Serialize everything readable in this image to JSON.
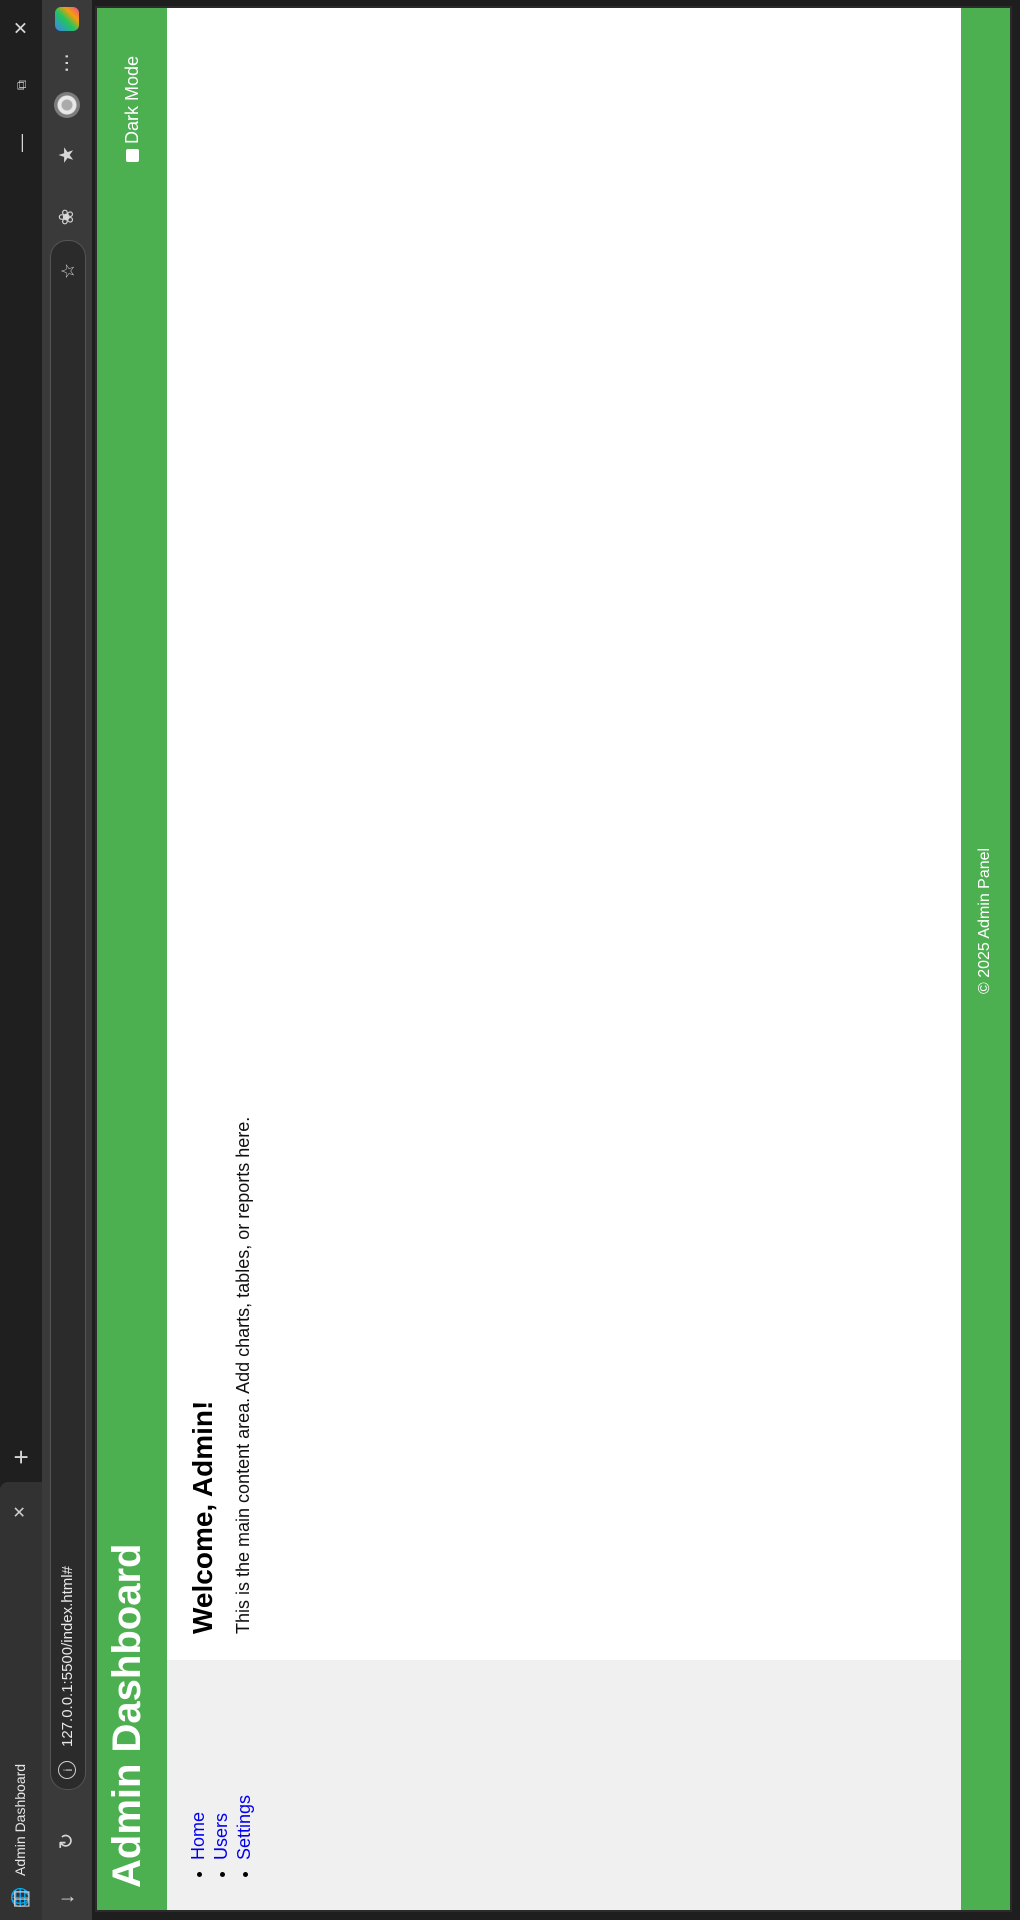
{
  "browser": {
    "tab_title": "Admin Dashboard",
    "url": "127.0.0.1:5500/index.html#",
    "icons": {
      "tab": "globe-icon",
      "tab_close": "close-icon",
      "new_tab": "plus-icon",
      "minimize": "minimize-icon",
      "maximize": "restore-icon",
      "close_window": "close-icon",
      "back": "arrow-down-icon",
      "reload": "refresh-icon",
      "info": "info-icon",
      "favorite": "star-plus-icon",
      "extensions": "puzzle-icon",
      "collections": "star-list-icon",
      "profile": "profile-icon",
      "menu": "ellipsis-icon",
      "copilot": "copilot-icon"
    }
  },
  "header": {
    "title": "Admin Dashboard",
    "dark_mode_label": "Dark Mode"
  },
  "sidebar": {
    "items": [
      {
        "label": "Home"
      },
      {
        "label": "Users"
      },
      {
        "label": "Settings"
      }
    ]
  },
  "main": {
    "heading": "Welcome, Admin!",
    "text": "This is the main content area. Add charts, tables, or reports here."
  },
  "footer": {
    "text": "© 2025 Admin Panel"
  },
  "colors": {
    "brand": "#4CAF50",
    "link": "#0000EE",
    "sidebar_bg": "#F0F0F0"
  }
}
